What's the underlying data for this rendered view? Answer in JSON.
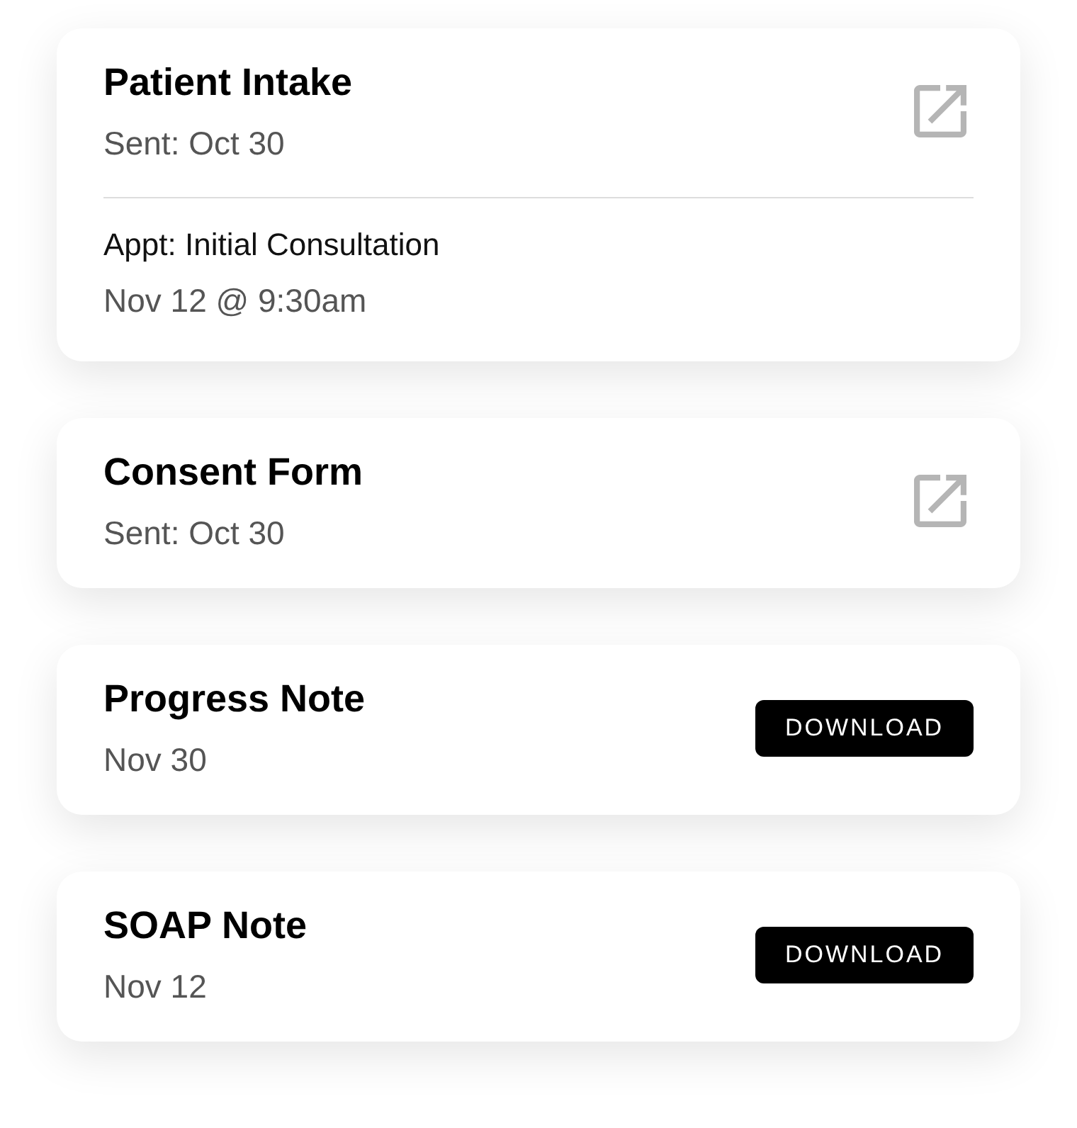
{
  "cards": [
    {
      "title": "Patient Intake",
      "subtitle": "Sent: Oct 30",
      "action": {
        "kind": "open"
      },
      "appointment": {
        "label": "Appt: Initial Consultation",
        "time": "Nov 12 @ 9:30am"
      }
    },
    {
      "title": "Consent Form",
      "subtitle": "Sent: Oct 30",
      "action": {
        "kind": "open"
      }
    },
    {
      "title": "Progress Note",
      "subtitle": "Nov 30",
      "action": {
        "kind": "download",
        "label": "DOWNLOAD"
      }
    },
    {
      "title": "SOAP Note",
      "subtitle": "Nov 12",
      "action": {
        "kind": "download",
        "label": "DOWNLOAD"
      }
    }
  ]
}
